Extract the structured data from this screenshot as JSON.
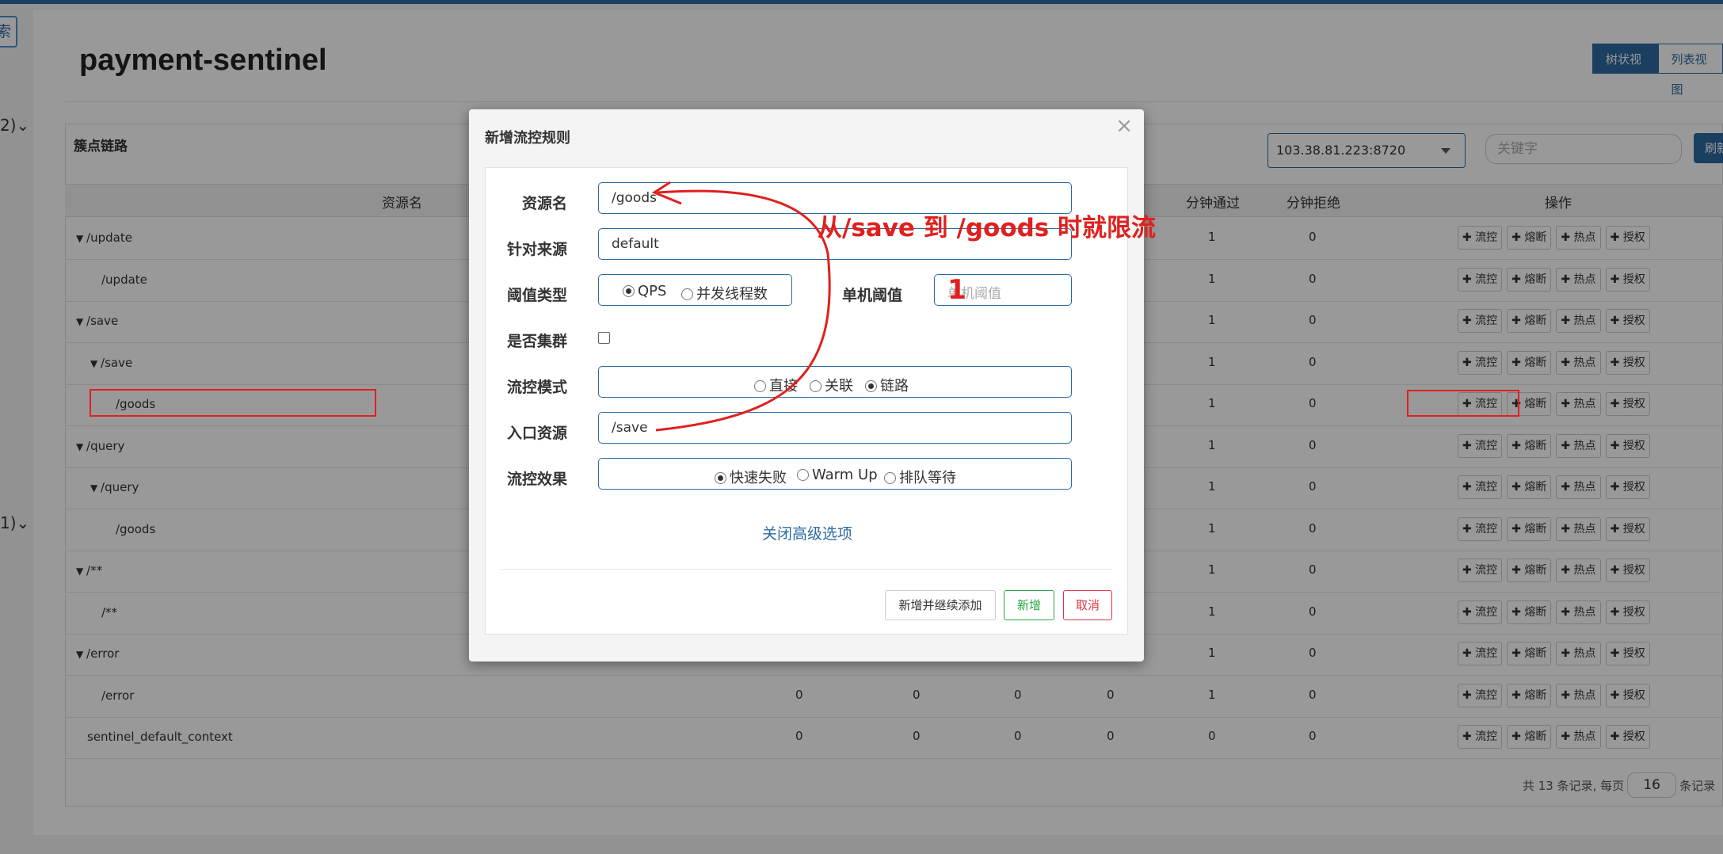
{
  "sidebar": {
    "search_fragment": "索",
    "mark1": "2)",
    "mark2": "1)"
  },
  "header": {
    "title": "payment-sentinel",
    "tree_view": "树状视图",
    "list_view": "列表视图"
  },
  "panel": {
    "title": "簇点链路",
    "machine": "103.38.81.223:8720",
    "keyword_placeholder": "关键字",
    "refresh": "刷新"
  },
  "table": {
    "columns": {
      "resource": "资源名",
      "pass_min": "分钟通过",
      "block_min": "分钟拒绝",
      "ops": "操作"
    },
    "op_labels": [
      "✚ 流控",
      "✚ 熔断",
      "✚ 热点",
      "✚ 授权"
    ],
    "rows": [
      {
        "name": "/update",
        "arrow": "▼",
        "pass": "1",
        "block": "0"
      },
      {
        "name": "/update",
        "arrow": "",
        "pass": "1",
        "block": "0"
      },
      {
        "name": "/save",
        "arrow": "▼",
        "pass": "1",
        "block": "0"
      },
      {
        "name": "/save",
        "arrow": "▼",
        "pass": "1",
        "block": "0"
      },
      {
        "name": "/goods",
        "arrow": "",
        "pass": "1",
        "block": "0"
      },
      {
        "name": "/query",
        "arrow": "▼",
        "pass": "1",
        "block": "0"
      },
      {
        "name": "/query",
        "arrow": "▼",
        "pass": "1",
        "block": "0"
      },
      {
        "name": "/goods",
        "arrow": "",
        "pass": "1",
        "block": "0"
      },
      {
        "name": "/**",
        "arrow": "▼",
        "pass": "1",
        "block": "0"
      },
      {
        "name": "/**",
        "arrow": "",
        "pass": "1",
        "block": "0"
      },
      {
        "name": "/error",
        "arrow": "▼",
        "pass": "1",
        "block": "0"
      },
      {
        "name": "/error",
        "arrow": "",
        "c1": "0",
        "c2": "0",
        "c3": "0",
        "c4": "0",
        "pass": "1",
        "block": "0"
      },
      {
        "name": "sentinel_default_context",
        "arrow": "",
        "c1": "0",
        "c2": "0",
        "c3": "0",
        "c4": "0",
        "pass": "0",
        "block": "0"
      }
    ]
  },
  "pager": {
    "prefix": "共 13 条记录, 每页",
    "page_size": "16",
    "suffix": "条记录"
  },
  "modal": {
    "title": "新增流控规则",
    "close": "×",
    "resource_label": "资源名",
    "resource_value": "/goods",
    "origin_label": "针对来源",
    "origin_value": "default",
    "threshold_type_label": "阈值类型",
    "threshold_type_options": [
      "QPS",
      "并发线程数"
    ],
    "threshold_label": "单机阈值",
    "threshold_placeholder": "单机阈值",
    "cluster_label": "是否集群",
    "mode_label": "流控模式",
    "mode_options": [
      "直接",
      "关联",
      "链路"
    ],
    "entry_label": "入口资源",
    "entry_value": "/save",
    "effect_label": "流控效果",
    "effect_options": [
      "快速失败",
      "Warm Up",
      "排队等待"
    ],
    "advanced_link": "关闭高级选项",
    "btn_add_continue": "新增并继续添加",
    "btn_add": "新增",
    "btn_cancel": "取消"
  },
  "annotations": {
    "note": "从/save 到 /goods 时就限流",
    "threshold_digit": "1",
    "color": "#e0201e"
  }
}
